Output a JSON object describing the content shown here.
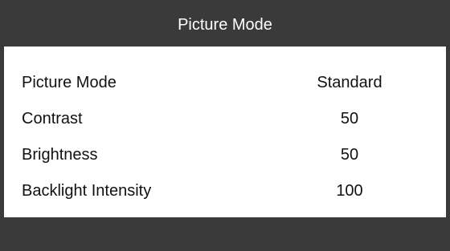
{
  "header": {
    "title": "Picture Mode"
  },
  "menu": {
    "items": [
      {
        "label": "Picture Mode",
        "value": "Standard"
      },
      {
        "label": "Contrast",
        "value": "50"
      },
      {
        "label": "Brightness",
        "value": "50"
      },
      {
        "label": "Backlight Intensity",
        "value": "100"
      }
    ]
  },
  "theme": {
    "bar_color": "#3a3a3a",
    "background": "#ffffff",
    "text_color": "#111111",
    "header_text_color": "#ffffff"
  }
}
